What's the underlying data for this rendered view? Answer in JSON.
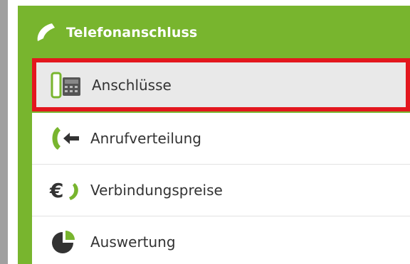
{
  "panel": {
    "title": "Telefonanschluss",
    "title_icon": "phone-handset-icon",
    "accent_color": "#78b52e",
    "highlight_color": "#e3171e"
  },
  "menu": {
    "items": [
      {
        "label": "Anschlüsse",
        "icon": "desk-phone-icon",
        "active": true
      },
      {
        "label": "Anrufverteilung",
        "icon": "call-forward-icon",
        "active": false
      },
      {
        "label": "Verbindungspreise",
        "icon": "euro-phone-icon",
        "active": false
      },
      {
        "label": "Auswertung",
        "icon": "pie-chart-icon",
        "active": false
      }
    ]
  }
}
